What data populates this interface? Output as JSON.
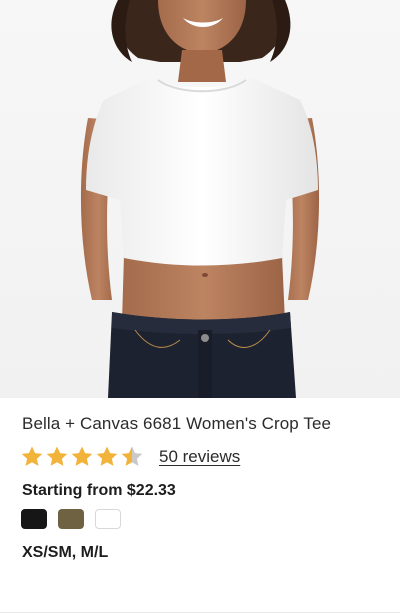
{
  "product": {
    "title": "Bella + Canvas 6681 Women's Crop Tee",
    "rating": 4.5,
    "rating_max": 5,
    "reviews_label": "50 reviews",
    "price_label": "Starting from $22.33",
    "sizes_label": "XS/SM, M/L",
    "colors": [
      {
        "name": "black",
        "hex": "#161616"
      },
      {
        "name": "olive",
        "hex": "#6e6243"
      },
      {
        "name": "white",
        "hex": "#ffffff"
      }
    ]
  },
  "theme": {
    "star_filled": "#f2b33a",
    "star_empty": "#c9c9c9"
  }
}
